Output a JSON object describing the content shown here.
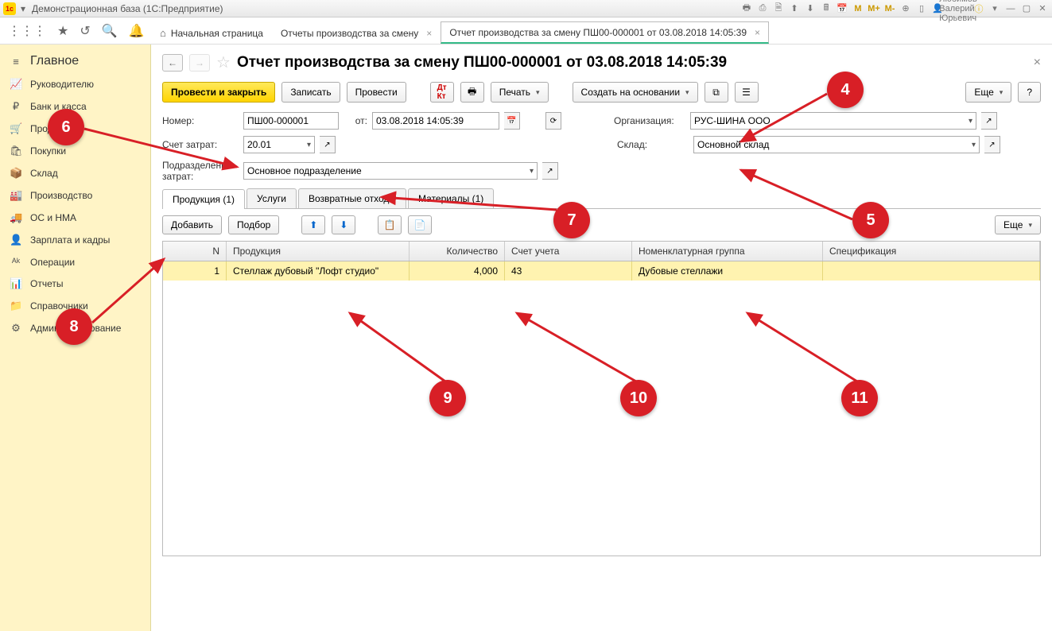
{
  "titlebar": {
    "title": "Демонстрационная база  (1С:Предприятие)",
    "user": "Любимов Валерий Юрьевич"
  },
  "topbar": {
    "m1": "M",
    "m2": "M+",
    "m3": "M-"
  },
  "tabs": {
    "home": "Начальная страница",
    "t1": "Отчеты производства за смену",
    "t2": "Отчет производства за смену ПШ00-000001 от 03.08.2018 14:05:39"
  },
  "nav": {
    "main": "Главное",
    "mgr": "Руководителю",
    "bank": "Банк и касса",
    "sales": "Продажи",
    "buy": "Покупки",
    "stock": "Склад",
    "prod": "Производство",
    "os": "ОС и НМА",
    "hr": "Зарплата и кадры",
    "ops": "Операции",
    "rep": "Отчеты",
    "ref": "Справочники",
    "adm": "Администрирование"
  },
  "page": {
    "title": "Отчет производства за смену ПШ00-000001 от 03.08.2018 14:05:39"
  },
  "tb": {
    "post_close": "Провести и закрыть",
    "write": "Записать",
    "post": "Провести",
    "print": "Печать",
    "create_based": "Создать на основании",
    "more": "Еще",
    "help": "?"
  },
  "form": {
    "num_lbl": "Номер:",
    "num": "ПШ00-000001",
    "from_lbl": "от:",
    "date": "03.08.2018 14:05:39",
    "org_lbl": "Организация:",
    "org": "РУС-ШИНА ООО",
    "acc_lbl": "Счет затрат:",
    "acc": "20.01",
    "wh_lbl": "Склад:",
    "wh": "Основной склад",
    "dept_lbl": "Подразделение затрат:",
    "dept": "Основное подразделение"
  },
  "doctabs": {
    "t1": "Продукция (1)",
    "t2": "Услуги",
    "t3": "Возвратные отходы",
    "t4": "Материалы (1)"
  },
  "subtb": {
    "add": "Добавить",
    "pick": "Подбор",
    "more": "Еще"
  },
  "thead": {
    "n": "N",
    "prod": "Продукция",
    "qty": "Количество",
    "acc": "Счет учета",
    "grp": "Номенклатурная группа",
    "spec": "Спецификация"
  },
  "row": {
    "n": "1",
    "prod": "Стеллаж дубовый \"Лофт студио\"",
    "qty": "4,000",
    "acc": "43",
    "grp": "Дубовые стеллажи",
    "spec": ""
  },
  "anno": {
    "a4": "4",
    "a5": "5",
    "a6": "6",
    "a7": "7",
    "a8": "8",
    "a9": "9",
    "a10": "10",
    "a11": "11"
  }
}
